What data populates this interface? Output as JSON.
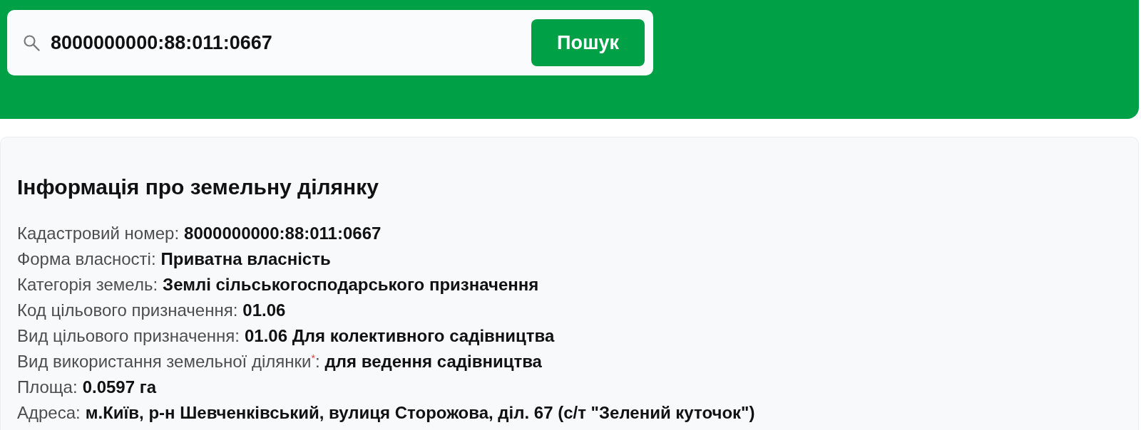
{
  "search": {
    "value": "8000000000:88:011:0667",
    "button": "Пошук"
  },
  "info": {
    "title": "Інформація про земельну ділянку",
    "rows": [
      {
        "label": "Кадастровий номер:",
        "value": "8000000000:88:011:0667"
      },
      {
        "label": "Форма власності:",
        "value": "Приватна власність"
      },
      {
        "label": "Категорія земель:",
        "value": "Землі сільськогосподарського призначення"
      },
      {
        "label": "Код цільового призначення:",
        "value": "01.06"
      },
      {
        "label": "Вид цільового призначення:",
        "value": "01.06 Для колективного садівництва"
      },
      {
        "label": "Вид використання земельної ділянки$^{*}$:",
        "value": "для ведення садівництва"
      },
      {
        "label": "Площа:",
        "value": "0.0597 га"
      },
      {
        "label": "Адреса:",
        "value": "м.Київ, р-н Шевченківський, вулиця Сторожова, діл. 67 (с/т \"Зелений куточок\")"
      }
    ]
  }
}
